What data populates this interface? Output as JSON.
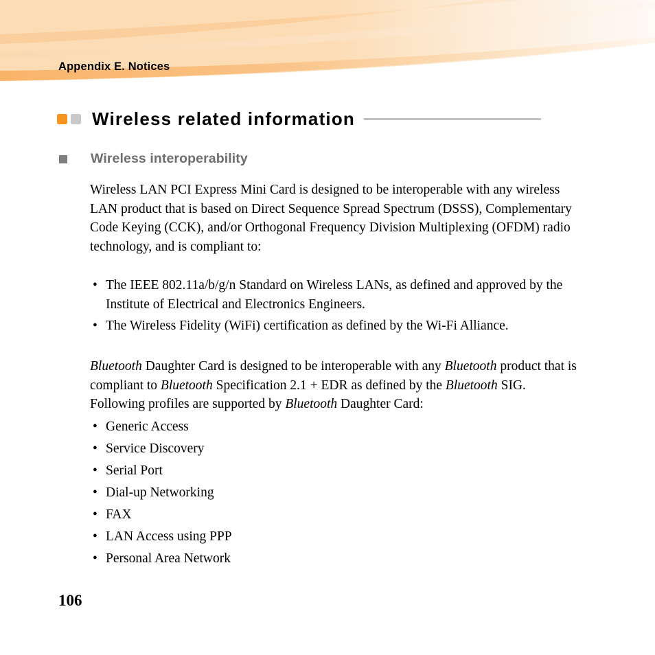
{
  "banner": {
    "chapter_title": "Appendix E. Notices",
    "base_color": "#FCDCB4",
    "accent_color": "#F9B872",
    "band_color": "#FBCB97"
  },
  "section": {
    "title": "Wireless related information",
    "bullet_colors": {
      "primary": "#F7941D",
      "secondary": "#C9C9C9"
    },
    "rule_color": "#C0C0C0"
  },
  "subsection": {
    "heading": "Wireless interoperability",
    "bullet_color": "#7E7E7E",
    "heading_color": "#6E6E6E"
  },
  "content": {
    "intro_paragraph": "Wireless LAN PCI Express Mini Card is designed to be interoperable with any wireless LAN product that is based on Direct Sequence Spread Spectrum (DSSS), Complementary Code Keying (CCK), and/or Orthogonal Frequency Division Multiplexing (OFDM) radio technology, and is compliant to:",
    "standards_bullets": [
      "The IEEE 802.11a/b/g/n Standard on Wireless LANs, as defined and approved by the Institute of Electrical and Electronics Engineers.",
      "The Wireless Fidelity (WiFi) certification as defined by the Wi-Fi Alliance."
    ],
    "bluetooth_paragraph": {
      "s1": "Bluetooth",
      "s2": " Daughter Card is designed to be interoperable with any ",
      "s3": "Bluetooth",
      "s4": " product that is compliant to ",
      "s5": "Bluetooth",
      "s6": " Specification 2.1 + EDR as defined by the ",
      "s7": "Bluetooth",
      "s8": " SIG. Following profiles are supported by ",
      "s9": "Bluetooth",
      "s10": " Daughter Card:"
    },
    "profile_bullets": [
      "Generic Access",
      "Service Discovery",
      "Serial Port",
      "Dial-up Networking",
      "FAX",
      "LAN Access using PPP",
      "Personal Area Network"
    ]
  },
  "footer": {
    "page_number": "106"
  }
}
